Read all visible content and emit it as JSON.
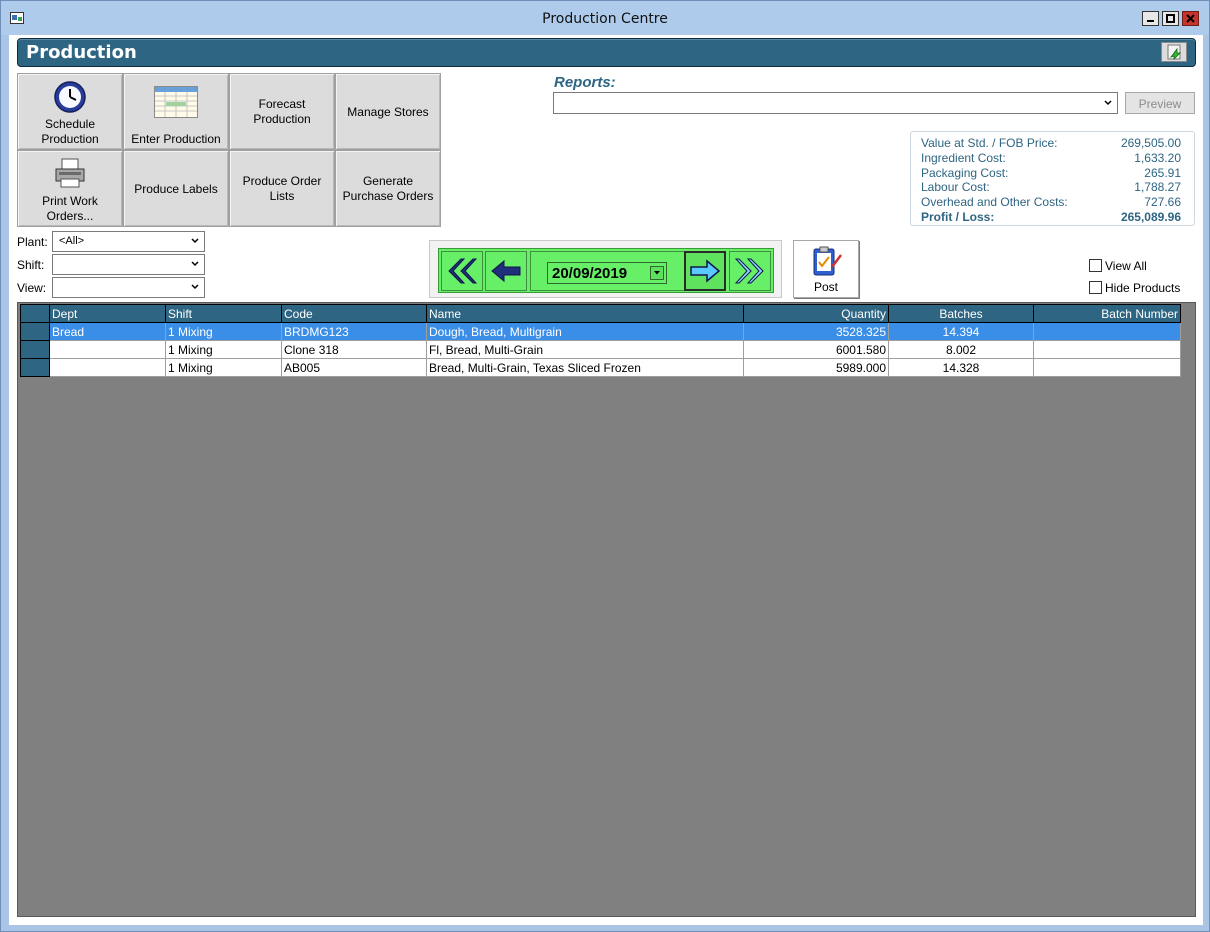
{
  "window": {
    "title": "Production Centre"
  },
  "header": {
    "title": "Production"
  },
  "tiles": [
    {
      "label": "Schedule Production",
      "line1": "Schedule",
      "line2": "Production",
      "icon": "clock-icon"
    },
    {
      "label": "Enter Production",
      "line1": "Enter Production",
      "icon": "spreadsheet-icon"
    },
    {
      "label": "Forecast Production",
      "line1": "Forecast",
      "line2": "Production"
    },
    {
      "label": "Manage Stores",
      "line1": "Manage Stores"
    },
    {
      "label": "Print Work Orders...",
      "line1": "Print Work",
      "line2": "Orders...",
      "icon": "printer-icon"
    },
    {
      "label": "Produce Labels",
      "line1": "Produce Labels"
    },
    {
      "label": "Produce Order Lists",
      "line1": "Produce Order",
      "line2": "Lists"
    },
    {
      "label": "Generate Purchase Orders",
      "line1": "Generate",
      "line2": "Purchase Orders"
    }
  ],
  "filters": {
    "plant_label": "Plant:",
    "plant_value": "<All>",
    "shift_label": "Shift:",
    "shift_value": "",
    "view_label": "View:",
    "view_value": ""
  },
  "reports": {
    "label": "Reports:",
    "selected": "",
    "preview_label": "Preview"
  },
  "costs": {
    "rows": [
      {
        "label": "Value at Std. / FOB Price:",
        "value": "269,505.00"
      },
      {
        "label": "Ingredient Cost:",
        "value": "1,633.20"
      },
      {
        "label": "Packaging Cost:",
        "value": "265.91"
      },
      {
        "label": "Labour Cost:",
        "value": "1,788.27"
      },
      {
        "label": "Overhead and Other Costs:",
        "value": "727.66"
      },
      {
        "label": "Profit / Loss:",
        "value": "265,089.96"
      }
    ]
  },
  "navigation": {
    "date": "20/09/2019",
    "icons": [
      "double-left-arrow-icon",
      "left-arrow-icon",
      "right-arrow-icon",
      "double-right-arrow-icon"
    ]
  },
  "post": {
    "label": "Post",
    "icon": "clipboard-check-icon"
  },
  "options": {
    "view_all_label": "View All",
    "view_all_checked": false,
    "hide_products_label": "Hide Products",
    "hide_products_checked": false
  },
  "grid": {
    "columns": [
      "Dept",
      "Shift",
      "Code",
      "Name",
      "Quantity",
      "Batches",
      "Batch Number"
    ],
    "rows": [
      {
        "dept": "Bread",
        "shift": "1 Mixing",
        "code": "BRDMG123",
        "name": "Dough, Bread, Multigrain",
        "quantity": "3528.325",
        "batches": "14.394",
        "batch_number": ""
      },
      {
        "dept": "",
        "shift": "1 Mixing",
        "code": "Clone 318",
        "name": "Fl, Bread, Multi-Grain",
        "quantity": "6001.580",
        "batches": "8.002",
        "batch_number": ""
      },
      {
        "dept": "",
        "shift": "1 Mixing",
        "code": "AB005",
        "name": "Bread, Multi-Grain, Texas Sliced Frozen",
        "quantity": "5989.000",
        "batches": "14.328",
        "batch_number": ""
      }
    ]
  },
  "colors": {
    "header_bg": "#2e6583",
    "nav_green": "#67ef67",
    "selected_row": "#3b8ee8",
    "grid_bg": "#808080",
    "title_bar": "#aecbeb"
  }
}
